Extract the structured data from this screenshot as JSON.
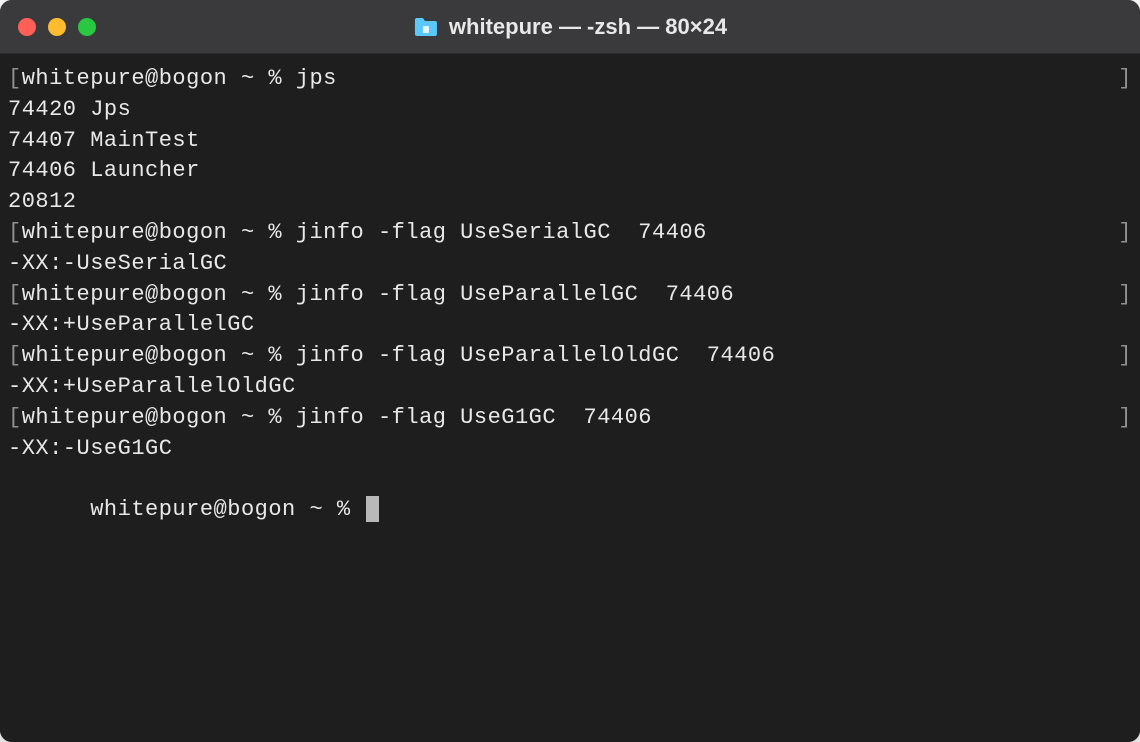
{
  "window": {
    "title": "whitepure — -zsh — 80×24"
  },
  "terminal": {
    "prompt": "whitepure@bogon ~ % ",
    "bracket_left": "[",
    "bracket_right": "]",
    "lines": [
      {
        "type": "prompt",
        "cmd": "jps"
      },
      {
        "type": "output",
        "text": "74420 Jps"
      },
      {
        "type": "output",
        "text": "74407 MainTest"
      },
      {
        "type": "output",
        "text": "74406 Launcher"
      },
      {
        "type": "output",
        "text": "20812"
      },
      {
        "type": "prompt",
        "cmd": "jinfo -flag UseSerialGC  74406"
      },
      {
        "type": "output",
        "text": "-XX:-UseSerialGC"
      },
      {
        "type": "prompt",
        "cmd": "jinfo -flag UseParallelGC  74406"
      },
      {
        "type": "output",
        "text": "-XX:+UseParallelGC"
      },
      {
        "type": "prompt",
        "cmd": "jinfo -flag UseParallelOldGC  74406"
      },
      {
        "type": "output",
        "text": "-XX:+UseParallelOldGC"
      },
      {
        "type": "prompt",
        "cmd": "jinfo -flag UseG1GC  74406"
      },
      {
        "type": "output",
        "text": "-XX:-UseG1GC"
      }
    ],
    "current_prompt": "whitepure@bogon ~ % "
  }
}
